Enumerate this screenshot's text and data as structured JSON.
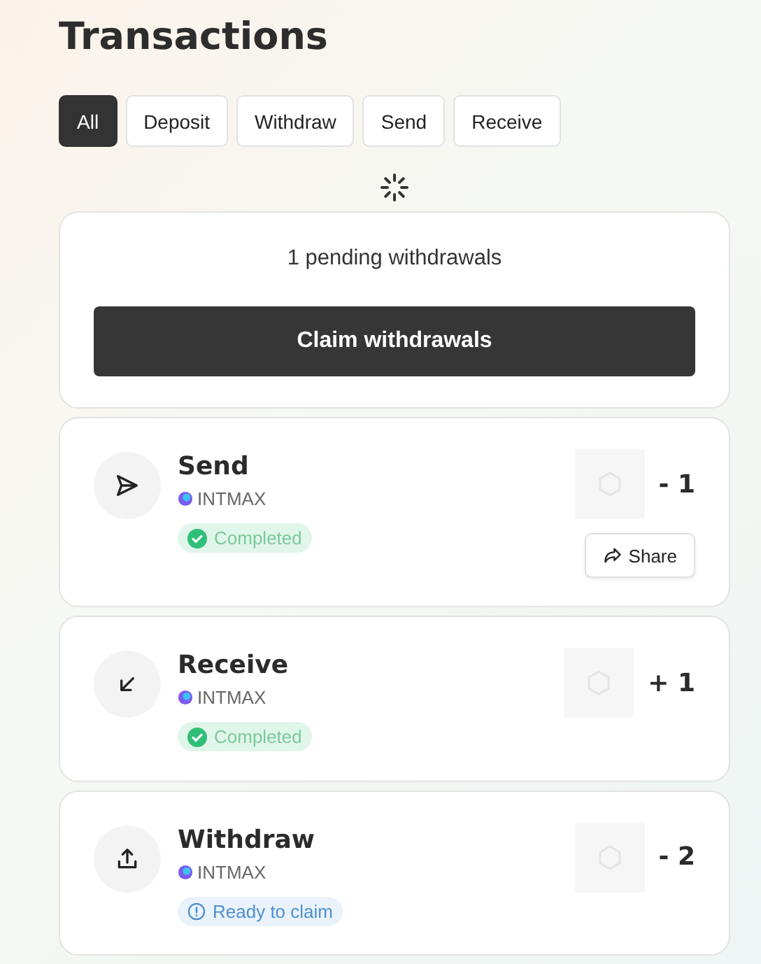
{
  "title": "Transactions",
  "filters": [
    {
      "label": "All",
      "selected": true
    },
    {
      "label": "Deposit",
      "selected": false
    },
    {
      "label": "Withdraw",
      "selected": false
    },
    {
      "label": "Send",
      "selected": false
    },
    {
      "label": "Receive",
      "selected": false
    }
  ],
  "pending": {
    "message": "1 pending withdrawals",
    "button": "Claim withdrawals"
  },
  "transactions": [
    {
      "kind": "send",
      "title": "Send",
      "token": "INTMAX",
      "status": {
        "kind": "completed",
        "label": "Completed"
      },
      "amount": "- 1",
      "share": "Share"
    },
    {
      "kind": "receive",
      "title": "Receive",
      "token": "INTMAX",
      "status": {
        "kind": "completed",
        "label": "Completed"
      },
      "amount": "+ 1"
    },
    {
      "kind": "withdraw",
      "title": "Withdraw",
      "token": "INTMAX",
      "status": {
        "kind": "ready",
        "label": "Ready to claim"
      },
      "amount": "- 2"
    }
  ]
}
